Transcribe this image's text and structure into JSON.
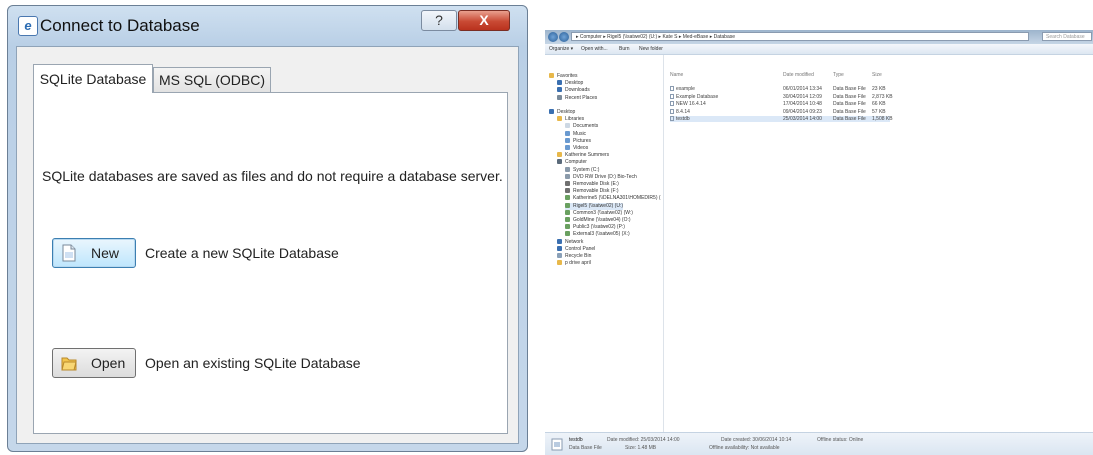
{
  "dialog": {
    "title": "Connect to Database",
    "help_glyph": "?",
    "close_glyph": "X",
    "tabs": [
      "SQLite Database",
      "MS SQL (ODBC)"
    ],
    "description": "SQLite databases are saved as files and do not require a database server.",
    "new_button": "New",
    "new_text": "Create a new SQLite Database",
    "open_button": "Open",
    "open_text": "Open an existing SQLite Database"
  },
  "explorer": {
    "address": "▸ Computer ▸ Rigel5 (\\\\satwe02) (U:) ▸ Kate S ▸ Med-eBase ▸ Database",
    "search_placeholder": "Search Database",
    "toolbar": [
      "Organize ▾",
      "Open with...",
      "Burn",
      "New folder"
    ],
    "nav": [
      "Favorites",
      "Desktop",
      "Downloads",
      "Recent Places",
      "",
      "Desktop",
      "Libraries",
      "Documents",
      "Music",
      "Pictures",
      "Videos",
      "Katherine Summers",
      "Computer",
      "System (C:)",
      "DVD RW Drive (D:) Bio-Tech",
      "Removable Disk (E:)",
      "Removable Disk (F:)",
      "Katherine5 (\\\\DELNA301\\HOMEDIR5) (",
      "Rigel5 (\\\\satwe02) (U:)",
      "Common3 (\\\\satwe02) (W:)",
      "GoldMine (\\\\satwe04) (O:)",
      "Public3 (\\\\satwe02) (P:)",
      "External3 (\\\\satwe05) (X:)",
      "Network",
      "Control Panel",
      "Recycle Bin",
      "p drive april"
    ],
    "columns": [
      "Name",
      "Date modified",
      "Type",
      "Size"
    ],
    "files": [
      {
        "name": "example",
        "date": "06/01/2014 13:34",
        "type": "Data Base File",
        "size": "23 KB"
      },
      {
        "name": "Example Database",
        "date": "30/04/2014 12:09",
        "type": "Data Base File",
        "size": "2,873 KB"
      },
      {
        "name": "NEW 16.4.14",
        "date": "17/04/2014 10:48",
        "type": "Data Base File",
        "size": "66 KB"
      },
      {
        "name": "8.4.14",
        "date": "09/04/2014 09:23",
        "type": "Data Base File",
        "size": "57 KB"
      },
      {
        "name": "testdb",
        "date": "25/03/2014 14:00",
        "type": "Data Base File",
        "size": "1,508 KB"
      }
    ],
    "status": {
      "name": "testdb",
      "type": "Data Base File",
      "modified": "Date modified: 25/03/2014 14:00",
      "size": "Size: 1.48 MB",
      "created": "Date created: 30/06/2014 10:14",
      "availability": "Offline availability: Not available",
      "offline": "Offline status: Online"
    }
  }
}
